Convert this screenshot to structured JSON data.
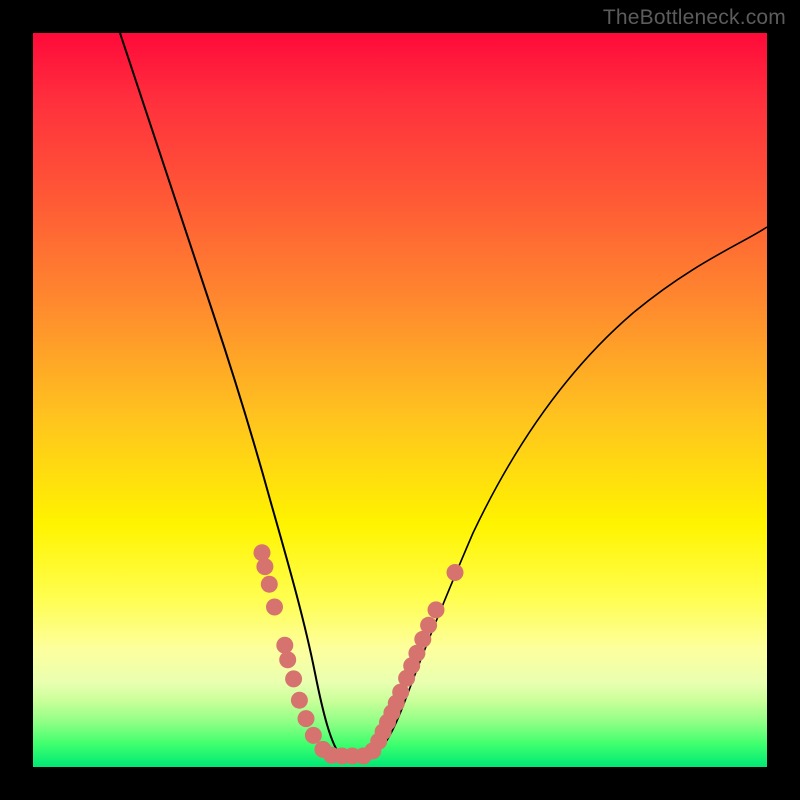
{
  "attribution": "TheBottleneck.com",
  "colors": {
    "frame": "#000000",
    "curve": "#000000",
    "dot": "#d6736f"
  },
  "chart_data": {
    "type": "line",
    "title": "",
    "xlabel": "",
    "ylabel": "",
    "xlim": [
      0,
      100
    ],
    "ylim": [
      0,
      100
    ],
    "series": [
      {
        "name": "left-curve",
        "x": [
          11.8,
          14,
          17,
          20,
          23,
          26,
          28,
          29.5,
          31,
          32,
          33,
          34,
          35,
          36,
          37,
          38,
          39,
          40
        ],
        "values": [
          100,
          92,
          82,
          72,
          62,
          51,
          42,
          36,
          30,
          26,
          22,
          18,
          14.5,
          11,
          8,
          5.5,
          3,
          1.5
        ]
      },
      {
        "name": "right-curve",
        "x": [
          46,
          47,
          48,
          49,
          50,
          52,
          55,
          58,
          62,
          66,
          72,
          80,
          90,
          100
        ],
        "values": [
          1.5,
          3,
          5,
          7,
          9.5,
          14,
          21,
          27,
          34.5,
          41,
          49,
          58,
          67,
          73.5
        ]
      },
      {
        "name": "flat-bottom",
        "x": [
          40,
          46
        ],
        "values": [
          1.5,
          1.5
        ]
      }
    ],
    "dots_left": [
      {
        "x": 31.2,
        "y": 29.2
      },
      {
        "x": 31.6,
        "y": 27.3
      },
      {
        "x": 32.2,
        "y": 24.9
      },
      {
        "x": 32.9,
        "y": 21.8
      },
      {
        "x": 34.3,
        "y": 16.6
      },
      {
        "x": 34.7,
        "y": 14.6
      },
      {
        "x": 35.5,
        "y": 12
      },
      {
        "x": 36.3,
        "y": 9.1
      },
      {
        "x": 37.2,
        "y": 6.6
      },
      {
        "x": 38.2,
        "y": 4.3
      },
      {
        "x": 39.5,
        "y": 2.4
      },
      {
        "x": 40.7,
        "y": 1.6
      },
      {
        "x": 42.1,
        "y": 1.5
      },
      {
        "x": 43.5,
        "y": 1.5
      },
      {
        "x": 45.0,
        "y": 1.5
      }
    ],
    "dots_right": [
      {
        "x": 46.3,
        "y": 2.2
      },
      {
        "x": 47.1,
        "y": 3.5
      },
      {
        "x": 47.7,
        "y": 4.8
      },
      {
        "x": 48.3,
        "y": 6.1
      },
      {
        "x": 48.9,
        "y": 7.4
      },
      {
        "x": 49.5,
        "y": 8.7
      },
      {
        "x": 50.1,
        "y": 10.2
      },
      {
        "x": 50.9,
        "y": 12.1
      },
      {
        "x": 51.6,
        "y": 13.8
      },
      {
        "x": 52.3,
        "y": 15.5
      },
      {
        "x": 53.1,
        "y": 17.4
      },
      {
        "x": 53.9,
        "y": 19.3
      },
      {
        "x": 54.9,
        "y": 21.4
      },
      {
        "x": 57.5,
        "y": 26.5
      }
    ]
  }
}
